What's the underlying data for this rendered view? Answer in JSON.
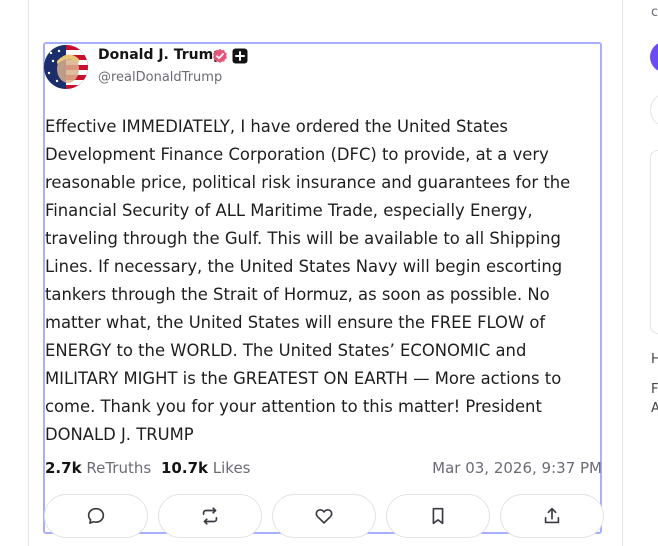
{
  "post": {
    "display_name": "Donald J. Trump",
    "handle": "@realDonaldTrump",
    "verified_icon": "verified-badge-icon",
    "badge_icon": "plus-badge-icon",
    "text": "Effective IMMEDIATELY, I have ordered the United States Development Finance Corporation (DFC) to provide, at a very reasonable price, political risk insurance and guarantees for the Financial Security of ALL Maritime Trade, especially Energy, traveling through the Gulf. This will be available to all Shipping Lines. If necessary, the United States Navy will begin escorting tankers through the Strait of Hormuz, as soon as possible. No matter what, the United States will ensure the FREE FLOW of ENERGY to the WORLD. The United States’ ECONOMIC and MILITARY MIGHT is the GREATEST ON EARTH — More actions to come. Thank you for your attention to this matter! President DONALD J. TRUMP",
    "retruths_count": "2.7k",
    "retruths_label": "ReTruths",
    "likes_count": "10.7k",
    "likes_label": "Likes",
    "timestamp": "Mar 03, 2026, 9:37 PM"
  },
  "actions": [
    {
      "name": "reply",
      "icon": "comment-icon"
    },
    {
      "name": "retruth",
      "icon": "repost-icon"
    },
    {
      "name": "like",
      "icon": "heart-icon"
    },
    {
      "name": "bookmark",
      "icon": "bookmark-icon"
    },
    {
      "name": "share",
      "icon": "share-icon"
    }
  ],
  "sidebar": {
    "frag_top": "c",
    "frag_h": "H",
    "frag_f": "F",
    "frag_a": "A"
  },
  "colors": {
    "focus_border": "#a7b0ff",
    "verified": "#e4567a",
    "accent_purple": "#6a4cf0",
    "text": "#1e1e1e",
    "muted": "#6b6b75"
  }
}
